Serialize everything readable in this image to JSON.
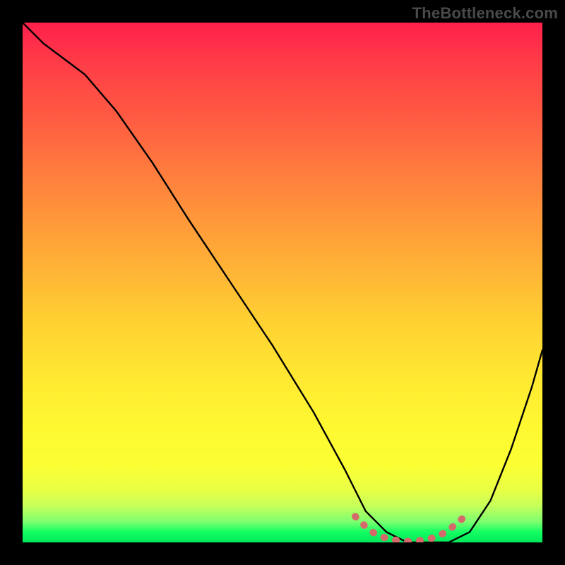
{
  "attribution": "TheBottleneck.com",
  "chart_data": {
    "type": "line",
    "title": "",
    "xlabel": "",
    "ylabel": "",
    "xlim": [
      0,
      100
    ],
    "ylim": [
      0,
      100
    ],
    "background_gradient": {
      "top": "#ff1f4b",
      "mid": "#ffe631",
      "bottom": "#00e85b",
      "meaning": "red-high to green-low bottleneck scale"
    },
    "series": [
      {
        "name": "bottleneck-curve",
        "color": "#000000",
        "x": [
          0,
          4,
          8,
          12,
          18,
          25,
          32,
          40,
          48,
          56,
          62,
          66,
          70,
          74,
          78,
          82,
          86,
          90,
          94,
          98,
          100
        ],
        "y": [
          100,
          96,
          93,
          90,
          83,
          73,
          62,
          50,
          38,
          25,
          14,
          6,
          2,
          0,
          0,
          0,
          2,
          8,
          18,
          30,
          37
        ]
      },
      {
        "name": "optimal-range-marker",
        "color": "#d46a6a",
        "x": [
          64,
          66,
          68,
          70,
          72,
          74,
          76,
          78,
          80,
          82,
          84,
          85
        ],
        "y": [
          5,
          3,
          1.5,
          0.8,
          0.4,
          0.2,
          0.3,
          0.6,
          1.2,
          2.4,
          4,
          5
        ]
      }
    ],
    "annotations": []
  }
}
